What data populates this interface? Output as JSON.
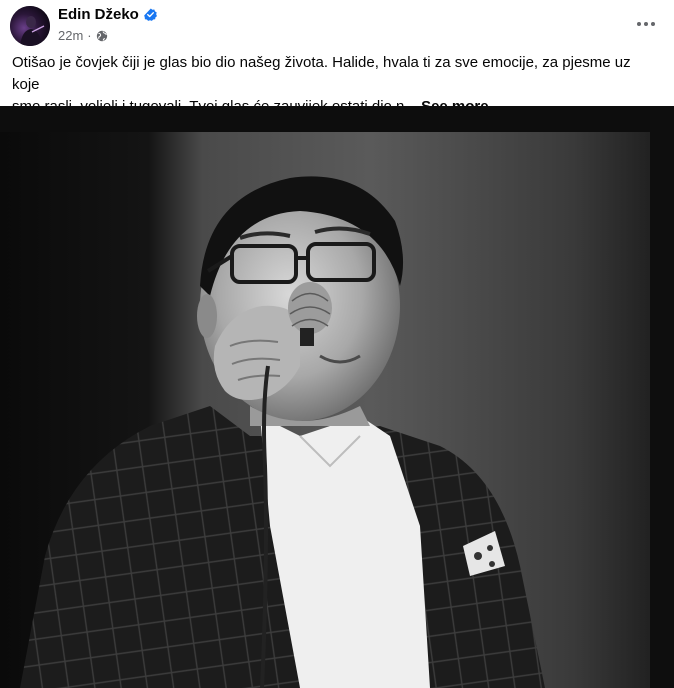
{
  "post": {
    "author": "Edin Džeko",
    "time": "22m",
    "separator": "·",
    "text_line1": "Otišao je čovjek čiji je glas bio dio našeg života. Halide, hvala ti za sve emocije, za pjesme uz koje",
    "text_line2": "smo rasli, voljeli i tugovali. Tvoj glas će zauvijek ostati dio n...",
    "see_more": "See more",
    "audience_icon": "globe-icon",
    "verified_icon": "verified-badge-icon",
    "more_icon": "more-options-icon"
  },
  "colors": {
    "verified": "#1877f2",
    "secondary_text": "#65676b",
    "primary_text": "#050505"
  }
}
